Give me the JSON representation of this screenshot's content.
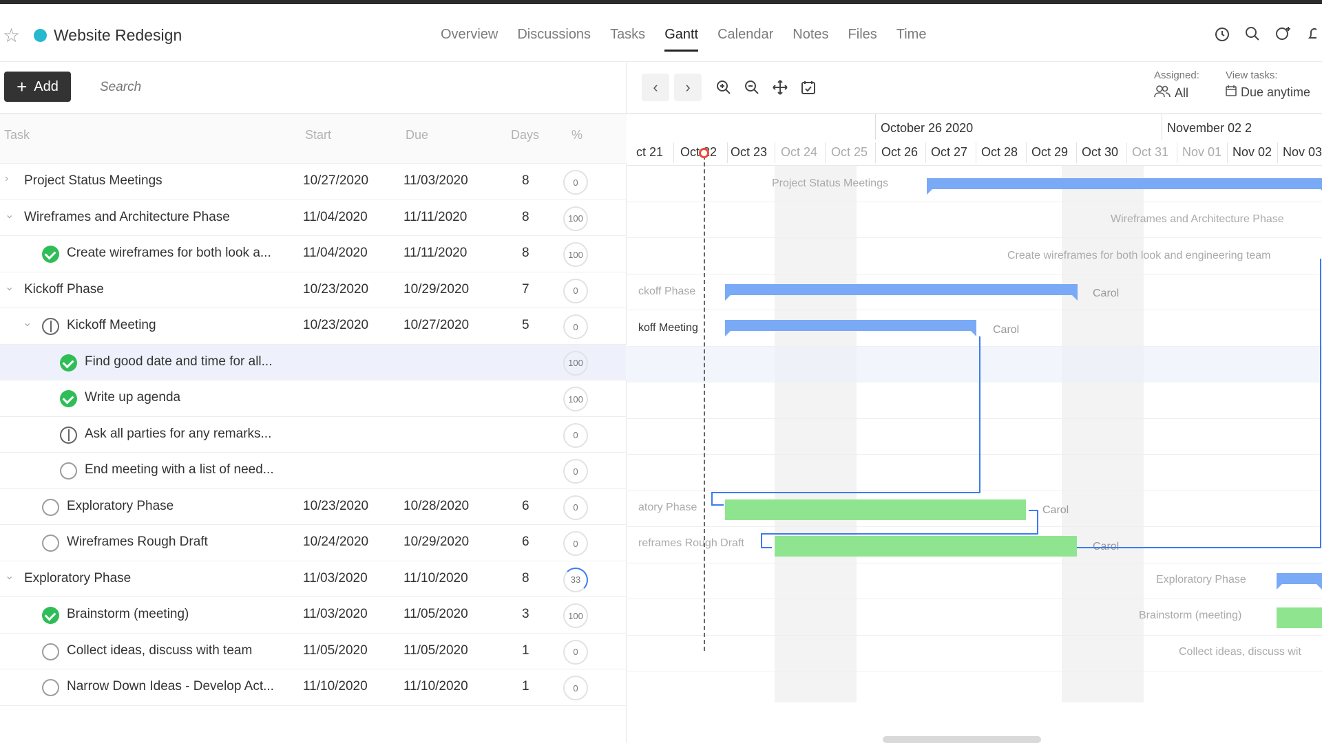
{
  "project": {
    "title": "Website Redesign",
    "dot_color": "#26b8cf"
  },
  "nav": [
    "Overview",
    "Discussions",
    "Tasks",
    "Gantt",
    "Calendar",
    "Notes",
    "Files",
    "Time"
  ],
  "nav_active": "Gantt",
  "toolbar": {
    "add_label": "Add",
    "search_placeholder": "Search"
  },
  "columns": {
    "task": "Task",
    "start": "Start",
    "due": "Due",
    "days": "Days",
    "pct": "%"
  },
  "rows": [
    {
      "name": "Project Status Meetings",
      "start": "10/27/2020",
      "due": "11/03/2020",
      "days": "8",
      "pct": "0"
    },
    {
      "name": "Wireframes and Architecture Phase",
      "start": "11/04/2020",
      "due": "11/11/2020",
      "days": "8",
      "pct": "100"
    },
    {
      "name": "Create wireframes for both look a...",
      "start": "11/04/2020",
      "due": "11/11/2020",
      "days": "8",
      "pct": "100"
    },
    {
      "name": "Kickoff Phase",
      "start": "10/23/2020",
      "due": "10/29/2020",
      "days": "7",
      "pct": "0"
    },
    {
      "name": "Kickoff Meeting",
      "start": "10/23/2020",
      "due": "10/27/2020",
      "days": "5",
      "pct": "0"
    },
    {
      "name": "Find good date and time for all...",
      "start": "",
      "due": "",
      "days": "",
      "pct": "100"
    },
    {
      "name": "Write up agenda",
      "start": "",
      "due": "",
      "days": "",
      "pct": "100"
    },
    {
      "name": "Ask all parties for any remarks...",
      "start": "",
      "due": "",
      "days": "",
      "pct": "0"
    },
    {
      "name": "End meeting with a list of need...",
      "start": "",
      "due": "",
      "days": "",
      "pct": "0"
    },
    {
      "name": "Exploratory Phase",
      "start": "10/23/2020",
      "due": "10/28/2020",
      "days": "6",
      "pct": "0"
    },
    {
      "name": "Wireframes Rough Draft",
      "start": "10/24/2020",
      "due": "10/29/2020",
      "days": "6",
      "pct": "0"
    },
    {
      "name": "Exploratory Phase",
      "start": "11/03/2020",
      "due": "11/10/2020",
      "days": "8",
      "pct": "33"
    },
    {
      "name": "Brainstorm (meeting)",
      "start": "11/03/2020",
      "due": "11/05/2020",
      "days": "3",
      "pct": "100"
    },
    {
      "name": "Collect ideas, discuss with team",
      "start": "11/05/2020",
      "due": "11/05/2020",
      "days": "1",
      "pct": "0"
    },
    {
      "name": "Narrow Down Ideas - Develop Act...",
      "start": "11/10/2020",
      "due": "11/10/2020",
      "days": "1",
      "pct": "0"
    }
  ],
  "gantt": {
    "assigned_label": "Assigned:",
    "assigned_value": "All",
    "view_label": "View tasks:",
    "view_value": "Due anytime",
    "months": [
      "October 26 2020",
      "November 02 2"
    ],
    "days": [
      "ct 21",
      "Oct 22",
      "Oct 23",
      "Oct 24",
      "Oct 25",
      "Oct 26",
      "Oct 27",
      "Oct 28",
      "Oct 29",
      "Oct 30",
      "Oct 31",
      "Nov 01",
      "Nov 02",
      "Nov 03"
    ],
    "labels": {
      "r0": "Project Status Meetings",
      "r1": "Wireframes and Architecture Phase",
      "r2": "Create wireframes for both look and engineering team",
      "r3": "ckoff Phase",
      "r4": "koff Meeting",
      "r9": "atory Phase",
      "r10": "reframes Rough Draft",
      "r11": "Exploratory Phase",
      "r12": "Brainstorm (meeting)",
      "r13": "Collect ideas, discuss wit"
    },
    "assignee": "Carol"
  }
}
